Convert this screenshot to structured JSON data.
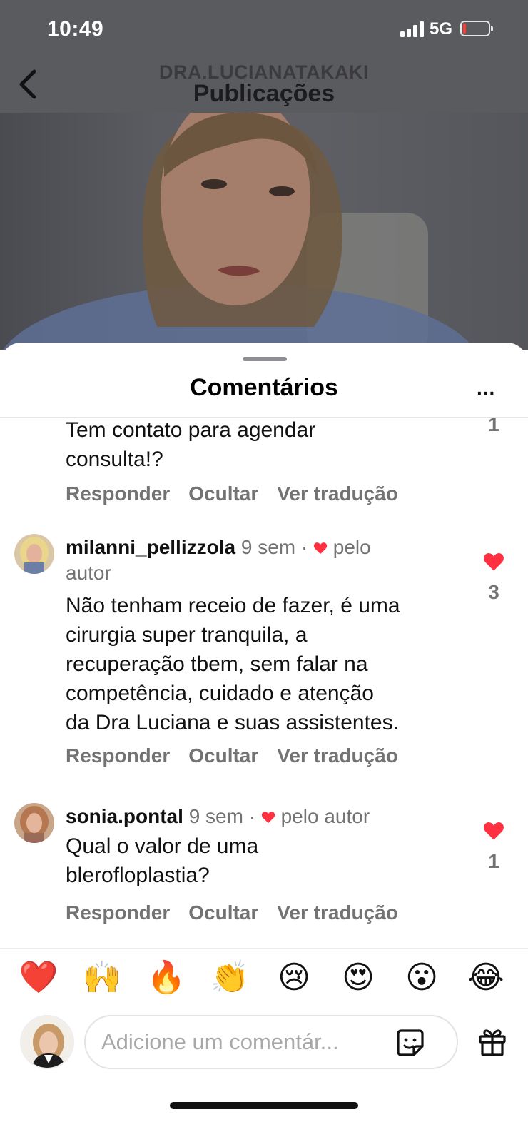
{
  "status_bar": {
    "time": "10:49",
    "network": "5G"
  },
  "nav": {
    "username": "DRA.LUCIANATAKAKI",
    "title": "Publicações"
  },
  "sheet": {
    "title": "Comentários",
    "more": "..."
  },
  "comments": [
    {
      "text": "Tem contato para agendar consulta!?",
      "text_lines": [
        "Tem contato para agendar",
        "consulta!?"
      ],
      "likes": "1",
      "actions": {
        "reply": "Responder",
        "hide": "Ocultar",
        "translate": "Ver tradução"
      }
    },
    {
      "username": "milanni_pellizzola",
      "time": "9 sem",
      "separator": "·",
      "liked_by_author": "pelo autor",
      "liked_by_author_lines": [
        "pelo",
        "autor"
      ],
      "text_lines": [
        "Não tenham receio de fazer, é uma",
        "cirurgia super tranquila, a",
        "recuperação tbem, sem falar na",
        "competência, cuidado e atenção",
        "da Dra Luciana e suas assistentes."
      ],
      "likes": "3",
      "actions": {
        "reply": "Responder",
        "hide": "Ocultar",
        "translate": "Ver tradução"
      }
    },
    {
      "username": "sonia.pontal",
      "time": "9 sem",
      "separator": "·",
      "liked_by_author": "pelo autor",
      "text_lines": [
        "Qual o valor de uma",
        "blerofloplastia?"
      ],
      "likes": "1",
      "actions": {
        "reply": "Responder",
        "hide": "Ocultar",
        "translate": "Ver tradução"
      }
    }
  ],
  "quick_reactions": [
    "❤️",
    "🙌",
    "🔥",
    "👏",
    "😢",
    "😍",
    "😮",
    "😂"
  ],
  "input": {
    "placeholder": "Adicione um comentár..."
  },
  "colors": {
    "like_red": "#ff3040",
    "secondary_text": "#737373",
    "dim_overlay": "#5a5b5f"
  },
  "icons": [
    "back-chevron-icon",
    "signal-icon",
    "battery-icon",
    "more-icon",
    "heart-icon",
    "sticker-icon",
    "gift-icon"
  ]
}
